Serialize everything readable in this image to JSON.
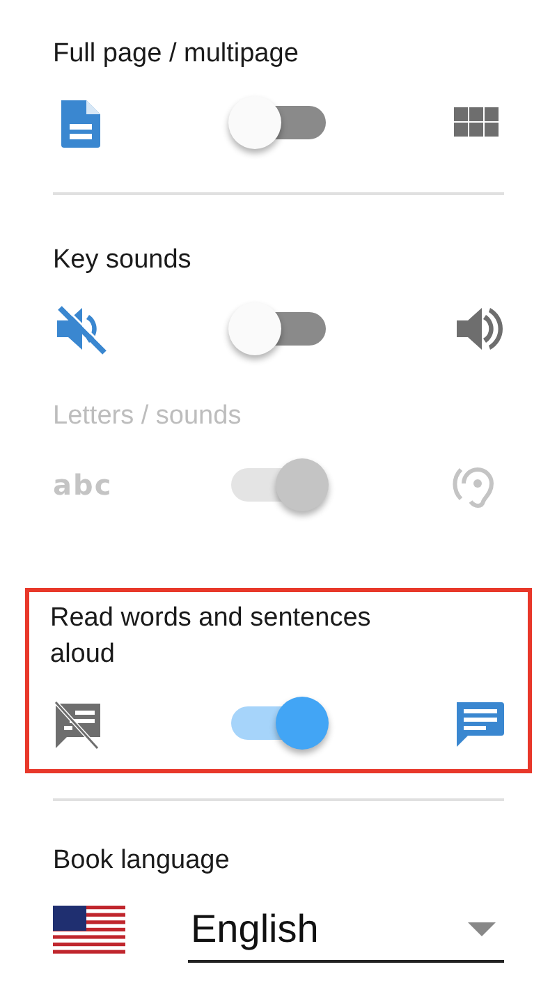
{
  "sections": [
    {
      "highlighted": false,
      "items": [
        {
          "label": "Full page / multipage",
          "on": false,
          "disabled": false
        }
      ]
    },
    {
      "highlighted": false,
      "items": [
        {
          "label": "Key sounds",
          "on": false,
          "disabled": false
        },
        {
          "label": "Letters / sounds",
          "on": true,
          "disabled": true,
          "left_glyph": "abc"
        }
      ]
    },
    {
      "highlighted": true,
      "items": [
        {
          "label": "Read words and sentences aloud",
          "on": true,
          "disabled": false
        }
      ]
    }
  ],
  "language": {
    "label": "Book language",
    "value": "English"
  }
}
